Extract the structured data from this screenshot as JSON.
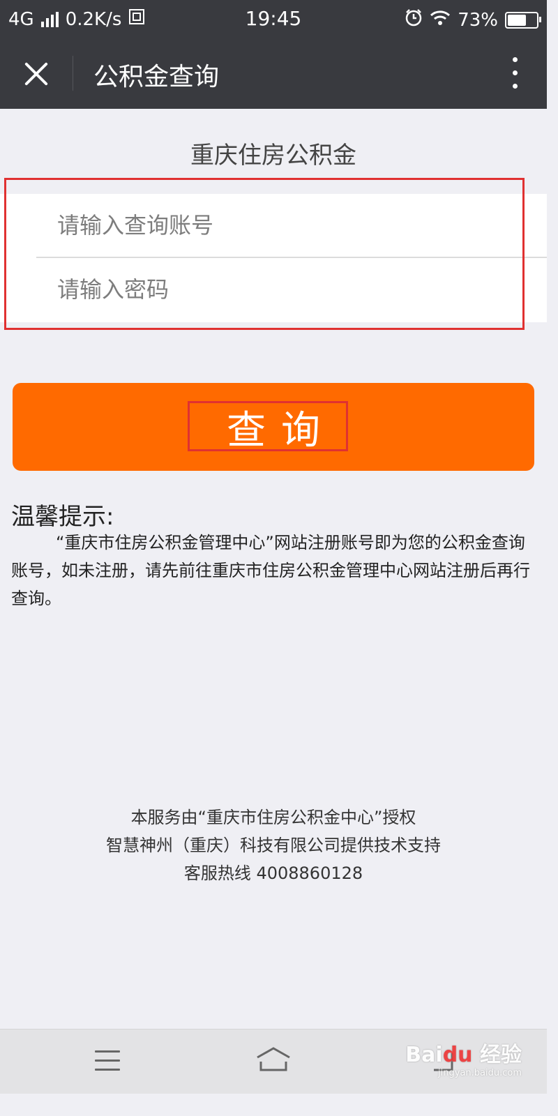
{
  "status_bar": {
    "network": "4G",
    "speed": "0.2K/s",
    "time": "19:45",
    "battery": "73%",
    "battery_level": 0.73,
    "icons": [
      "signal-icon",
      "sim-icon",
      "alarm-icon",
      "wifi-icon",
      "battery-icon"
    ]
  },
  "nav": {
    "title": "公积金查询",
    "close_icon": "close-icon",
    "more_icon": "more-vertical-icon"
  },
  "main": {
    "section_title": "重庆住房公积金",
    "account_placeholder": "请输入查询账号",
    "password_placeholder": "请输入密码",
    "query_button": "查询"
  },
  "tips": {
    "heading": "温馨提示:",
    "body": "“重庆市住房公积金管理中心”网站注册账号即为您的公积金查询账号，如未注册，请先前往重庆市住房公积金管理中心网站注册后再行查询。"
  },
  "footer": {
    "line1": "本服务由“重庆市住房公积金中心”授权",
    "line2": "智慧神州（重庆）科技有限公司提供技术支持",
    "line3": "客服热线 4008860128"
  },
  "bottom_bar": {
    "icons": [
      "menu-icon",
      "home-icon",
      "back-icon"
    ]
  },
  "watermark": {
    "logo_text": "Baidu 经验",
    "url": "jingyan.baidu.com"
  },
  "colors": {
    "nav_bg": "#393a3f",
    "page_bg": "#efeff4",
    "button": "#ff6a00",
    "annotation": "#e03131"
  }
}
